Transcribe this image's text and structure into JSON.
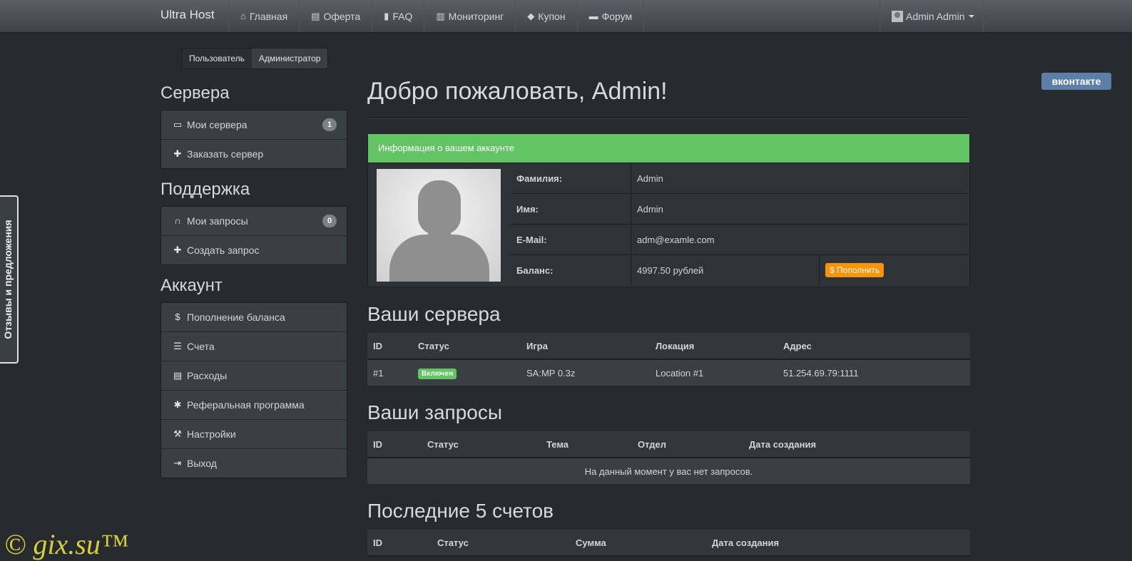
{
  "navbar": {
    "brand": "Ultra Host",
    "items": [
      {
        "icon": "home-icon",
        "label": "Главная"
      },
      {
        "icon": "document-icon",
        "label": "Оферта"
      },
      {
        "icon": "book-icon",
        "label": "FAQ"
      },
      {
        "icon": "bar-chart-icon",
        "label": "Мониторинг"
      },
      {
        "icon": "tag-icon",
        "label": "Купон"
      },
      {
        "icon": "comment-icon",
        "label": "Форум"
      }
    ],
    "user": "Admin Admin"
  },
  "role_toggle": {
    "user": "Пользователь",
    "admin": "Администратор"
  },
  "sidebar": {
    "servers_title": "Сервера",
    "servers": [
      {
        "label": "Мои сервера",
        "badge": "1",
        "icon": "hdd-icon"
      },
      {
        "label": "Заказать сервер",
        "icon": "plus-icon"
      }
    ],
    "support_title": "Поддержка",
    "support": [
      {
        "label": "Мои запросы",
        "badge": "0",
        "icon": "headphones-icon"
      },
      {
        "label": "Создать запрос",
        "icon": "plus-icon"
      }
    ],
    "account_title": "Аккаунт",
    "account": [
      {
        "label": "Пополнение баланса",
        "icon": "dollar-icon"
      },
      {
        "label": "Счета",
        "icon": "list-icon"
      },
      {
        "label": "Расходы",
        "icon": "list-alt-icon"
      },
      {
        "label": "Реферальная программа",
        "icon": "asterisk-icon"
      },
      {
        "label": "Настройки",
        "icon": "wrench-icon"
      },
      {
        "label": "Выход",
        "icon": "logout-icon"
      }
    ]
  },
  "main": {
    "welcome": "Добро пожаловать, Admin!",
    "account_panel": {
      "title": "Информация о вашем аккаунте",
      "rows": [
        {
          "label": "Фамилия:",
          "value": "Admin"
        },
        {
          "label": "Имя:",
          "value": "Admin"
        },
        {
          "label": "E-Mail:",
          "value": "adm@examle.com"
        },
        {
          "label": "Баланс:",
          "value": "4997.50 рублей"
        }
      ],
      "topup_label": "Пополнить"
    },
    "servers": {
      "title": "Ваши сервера",
      "headers": [
        "ID",
        "Статус",
        "Игра",
        "Локация",
        "Адрес"
      ],
      "rows": [
        {
          "id": "#1",
          "status": "Включен",
          "game": "SA:MP 0.3z",
          "location": "Location #1",
          "address": "51.254.69.79:1111"
        }
      ]
    },
    "requests": {
      "title": "Ваши запросы",
      "headers": [
        "ID",
        "Статус",
        "Тема",
        "Отдел",
        "Дата создания"
      ],
      "empty": "На данный момент у вас нет запросов."
    },
    "invoices": {
      "title": "Последние 5 счетов",
      "headers": [
        "ID",
        "Статус",
        "Сумма",
        "Дата создания"
      ]
    }
  },
  "feedback_tab": "Отзывы и предложения",
  "vk_label": "вконтакте",
  "watermark": "© gix.su™"
}
